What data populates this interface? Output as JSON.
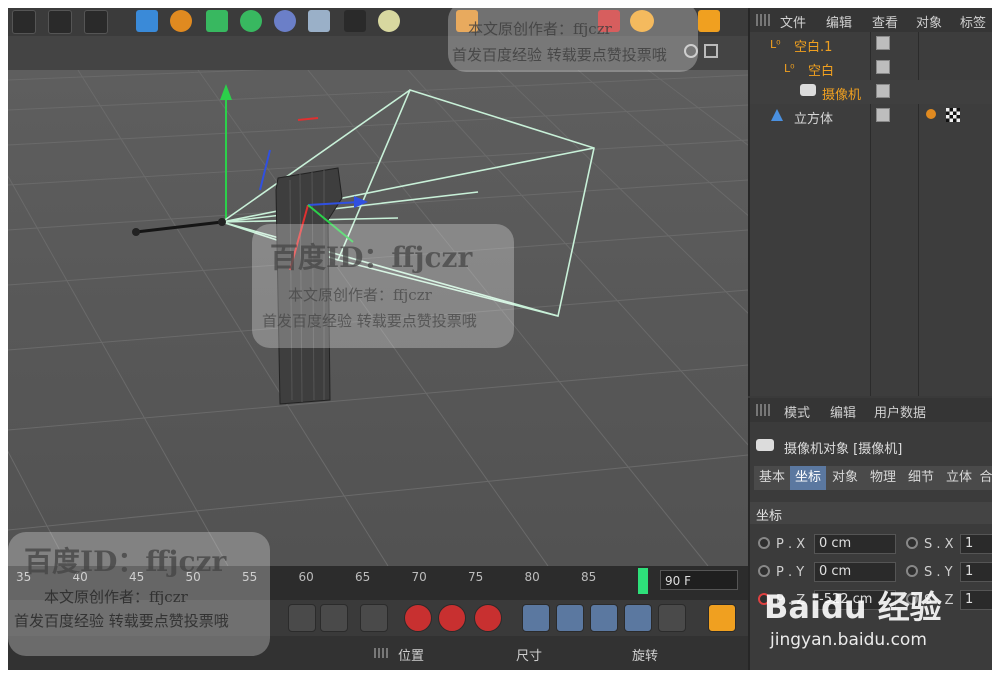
{
  "object_manager": {
    "menu": [
      "文件",
      "编辑",
      "查看",
      "对象",
      "标签"
    ],
    "objects": [
      {
        "label": "空白.1",
        "color": "#f0a020"
      },
      {
        "label": "空白",
        "color": "#f0a020"
      },
      {
        "label": "摄像机",
        "color": "#f0a020"
      },
      {
        "label": "立方体",
        "color": "#d6d6d6"
      }
    ]
  },
  "attribute_manager": {
    "menu": [
      "模式",
      "编辑",
      "用户数据"
    ],
    "title": "摄像机对象 [摄像机]",
    "tabs": [
      "基本",
      "坐标",
      "对象",
      "物理",
      "细节",
      "立体",
      "合"
    ],
    "active_tab": "坐标",
    "section": "坐标",
    "rows": [
      {
        "p_label": "P . X",
        "p_value": "0 cm",
        "s_label": "S . X",
        "s_value": "1"
      },
      {
        "p_label": "P . Y",
        "p_value": "0 cm",
        "s_label": "S . Y",
        "s_value": "1"
      },
      {
        "p_label": "P . Z",
        "p_value": "-522 cm",
        "s_label": "S . Z",
        "s_value": "1"
      }
    ]
  },
  "timeline": {
    "ticks": [
      "35",
      "40",
      "45",
      "50",
      "55",
      "60",
      "65",
      "70",
      "75",
      "80",
      "85"
    ],
    "end_frame": "90 F",
    "current_marker_color": "#2ee07a"
  },
  "bottom_tabs": [
    "位置",
    "尺寸",
    "旋转"
  ],
  "watermarks": {
    "baidu_id": "百度ID：ffjczr",
    "author": "本文原创作者：ffjczr",
    "notice": "首发百度经验 转载要点赞投票哦",
    "brand": "Baidu 经验",
    "url": "jingyan.baidu.com"
  },
  "colors": {
    "viewport_bg": "#585858",
    "frustum": "#c8f0d8",
    "accent_orange": "#f0a020",
    "active_tab": "#5b78a0"
  }
}
